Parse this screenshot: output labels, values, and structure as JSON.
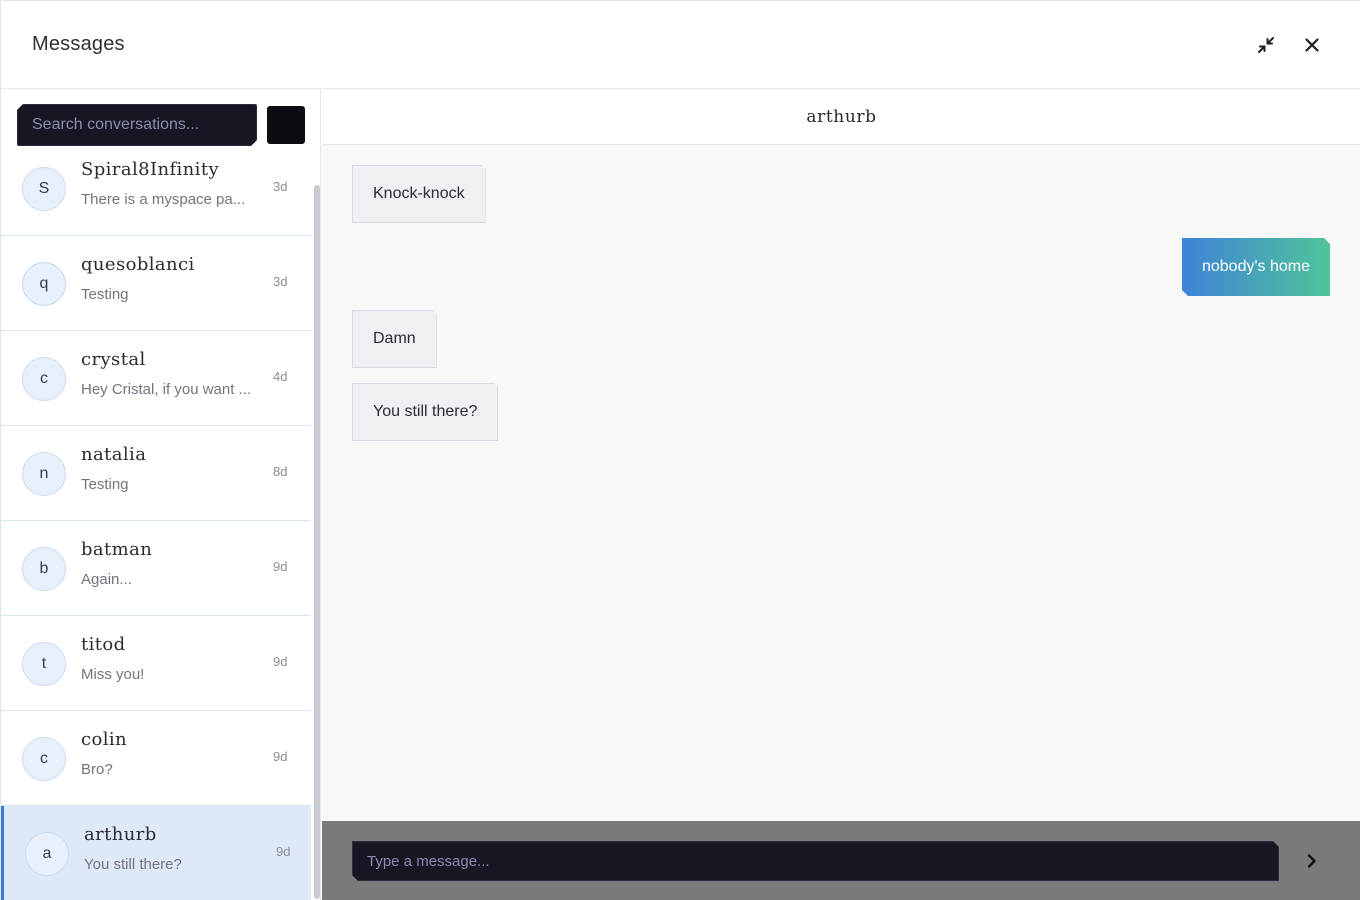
{
  "header": {
    "title": "Messages",
    "minimize_icon": "collapse-arrows-icon",
    "close_icon": "close-icon"
  },
  "sidebar": {
    "search_placeholder": "Search conversations...",
    "conversations": [
      {
        "initial": "S",
        "name": "Spiral8Infinity",
        "preview": "There is a myspace pa...",
        "time": "3d"
      },
      {
        "initial": "q",
        "name": "quesoblanci",
        "preview": "Testing",
        "time": "3d"
      },
      {
        "initial": "c",
        "name": "crystal",
        "preview": "Hey Cristal, if you want ...",
        "time": "4d"
      },
      {
        "initial": "n",
        "name": "natalia",
        "preview": "Testing",
        "time": "8d"
      },
      {
        "initial": "b",
        "name": "batman",
        "preview": "Again...",
        "time": "9d"
      },
      {
        "initial": "t",
        "name": "titod",
        "preview": "Miss you!",
        "time": "9d"
      },
      {
        "initial": "c",
        "name": "colin",
        "preview": "Bro?",
        "time": "9d"
      },
      {
        "initial": "a",
        "name": "arthurb",
        "preview": "You still there?",
        "time": "9d",
        "active": true
      }
    ]
  },
  "chat": {
    "title": "arthurb",
    "messages": [
      {
        "direction": "incoming",
        "text": "Knock-knock"
      },
      {
        "direction": "outgoing",
        "text": "nobody's home"
      },
      {
        "direction": "incoming",
        "text": "Damn"
      },
      {
        "direction": "incoming",
        "text": "You still there?"
      }
    ],
    "input_placeholder": "Type a message...",
    "send_icon": "chevron-right-icon"
  },
  "colors": {
    "accent_blue": "#3f83d8",
    "accent_green": "#4fc49a",
    "active_row": "#dde9f7",
    "input_dark": "#161722"
  }
}
